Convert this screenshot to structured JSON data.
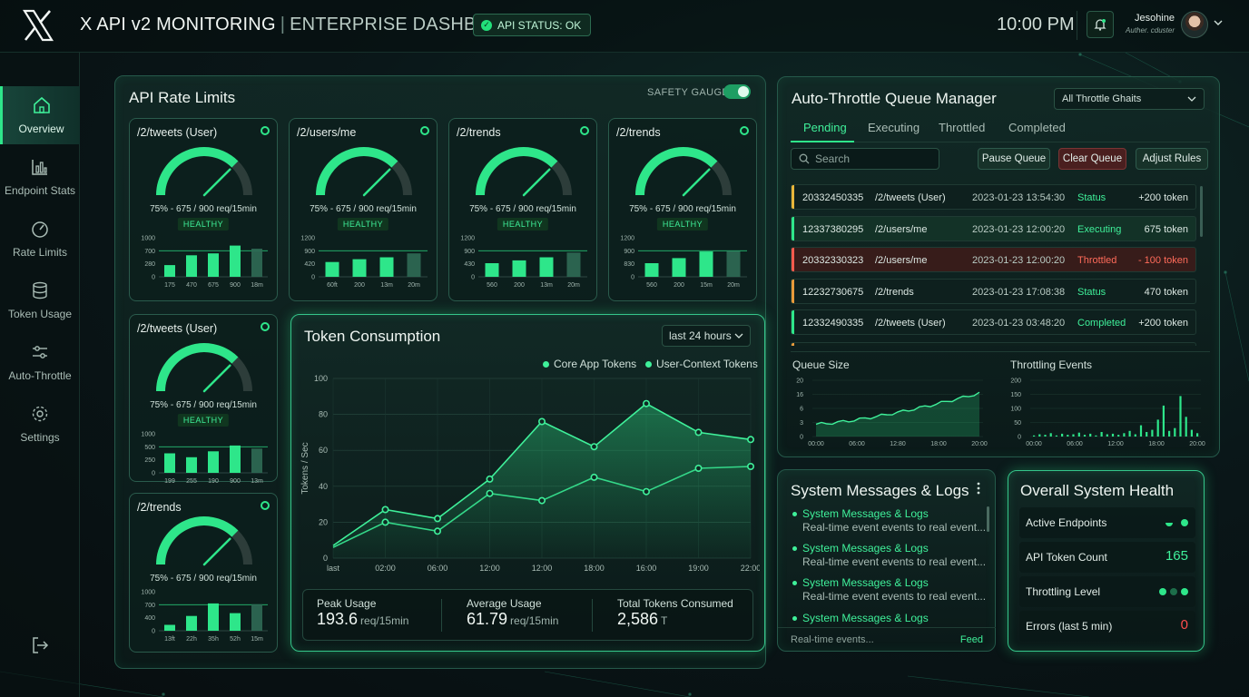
{
  "header": {
    "brand_main": "X API v2 MONITORING",
    "brand_sep": "|",
    "brand_sub": "ENTERPRISE DASHBOARD",
    "api_status": "API STATUS: OK",
    "time": "10:00 PM",
    "user_name": "Jesohine",
    "user_role": "Auther. cduster",
    "icons": {
      "logo": "x-logo-icon",
      "bell": "bell-icon",
      "chevron": "chevron-down-icon"
    }
  },
  "sidebar": {
    "items": [
      {
        "label": "Overview",
        "icon": "home-icon",
        "active": true
      },
      {
        "label": "Endpoint Stats",
        "icon": "bar-chart-icon",
        "active": false
      },
      {
        "label": "Rate Limits",
        "icon": "gauge-icon",
        "active": false
      },
      {
        "label": "Token Usage",
        "icon": "database-icon",
        "active": false
      },
      {
        "label": "Auto-Throttle",
        "icon": "sliders-icon",
        "active": false
      },
      {
        "label": "Settings",
        "icon": "gear-icon",
        "active": false
      }
    ],
    "logout_icon": "logout-icon"
  },
  "rate_limits": {
    "title": "API Rate Limits",
    "safety_label": "SAFETY GAUGE:",
    "safety_on": true,
    "endpoints": [
      {
        "name": "/2/tweets (User)",
        "reading": "75% - 675 / 900 req/15min",
        "usage": 0.75,
        "status": "HEALTHY",
        "bars": {
          "yticks": [
            "1000",
            "700",
            "280",
            "0"
          ],
          "xlabels": [
            "175",
            "470",
            "675",
            "900",
            "18m"
          ],
          "values": [
            0.3,
            0.55,
            0.6,
            0.8,
            0.72
          ]
        }
      },
      {
        "name": "/2/users/me",
        "reading": "75% - 675 / 900 req/15min",
        "usage": 0.75,
        "status": "HEALTHY",
        "bars": {
          "yticks": [
            "1200",
            "900",
            "420",
            "0"
          ],
          "xlabels": [
            "60ft",
            "200",
            "13m",
            "20m"
          ],
          "values": [
            0.38,
            0.45,
            0.5,
            0.6
          ]
        }
      },
      {
        "name": "/2/trends",
        "reading": "75% - 675 / 900 req/15min",
        "usage": 0.75,
        "status": "HEALTHY",
        "bars": {
          "yticks": [
            "1200",
            "900",
            "430",
            "0"
          ],
          "xlabels": [
            "560",
            "200",
            "13m",
            "20m"
          ],
          "values": [
            0.35,
            0.42,
            0.5,
            0.62
          ]
        }
      },
      {
        "name": "/2/trends",
        "reading": "75% - 675 / 900 req/15min",
        "usage": 0.75,
        "status": "HEALTHY",
        "bars": {
          "yticks": [
            "1200",
            "900",
            "830",
            "0"
          ],
          "xlabels": [
            "560",
            "200",
            "15m",
            "20m"
          ],
          "values": [
            0.35,
            0.48,
            0.65,
            0.66
          ]
        }
      },
      {
        "name": "/2/tweets (User)",
        "reading": "75% - 675 / 900 req/15min",
        "usage": 0.75,
        "status": "HEALTHY",
        "bars": {
          "yticks": [
            "1000",
            "500",
            "250",
            "0"
          ],
          "xlabels": [
            "199",
            "255",
            "190",
            "900",
            "13m"
          ],
          "values": [
            0.5,
            0.4,
            0.55,
            0.7,
            0.62
          ]
        }
      },
      {
        "name": "/2/trends",
        "reading": "75% - 675 / 900 req/15min",
        "usage": 0.75,
        "status": "",
        "bars": {
          "yticks": [
            "1000",
            "700",
            "400",
            "0"
          ],
          "xlabels": [
            "13ft",
            "22h",
            "35h",
            "52h",
            "15m"
          ],
          "values": [
            0.15,
            0.38,
            0.7,
            0.45,
            0.68
          ]
        }
      }
    ]
  },
  "token_consumption": {
    "title": "Token Consumption",
    "range": "last 24 hours",
    "legend": [
      "Core App Tokens",
      "User-Context Tokens"
    ],
    "stats": [
      {
        "label": "Peak Usage",
        "value": "193.6",
        "unit": "req/15min"
      },
      {
        "label": "Average Usage",
        "value": "61.79",
        "unit": "req/15min"
      },
      {
        "label": "Total Tokens Consumed",
        "value": "2,586",
        "unit": "T"
      }
    ]
  },
  "chart_data": {
    "type": "area",
    "title": "Token Consumption",
    "xlabel": "",
    "ylabel": "Tokens / Sec",
    "ylim": [
      0,
      100
    ],
    "yticks": [
      0,
      20,
      40,
      60,
      80,
      100
    ],
    "x": [
      "last",
      "02:00",
      "06:00",
      "12:00",
      "12:00",
      "18:00",
      "16:00",
      "19:00",
      "22:00"
    ],
    "series": [
      {
        "name": "Core App Tokens",
        "values": [
          7,
          27,
          22,
          44,
          76,
          62,
          86,
          70,
          66
        ]
      },
      {
        "name": "User-Context Tokens",
        "values": [
          6,
          20,
          15,
          36,
          32,
          45,
          37,
          50,
          51
        ]
      }
    ],
    "grid": true,
    "legend_position": "top-right"
  },
  "queue": {
    "title": "Auto-Throttle Queue Manager",
    "filter": "All Throttle Ghaits",
    "tabs": [
      "Pending",
      "Executing",
      "Throttled",
      "Completed"
    ],
    "active_tab": 0,
    "search_placeholder": "Search",
    "buttons": [
      "Pause Queue",
      "Clear Queue",
      "Adjust Rules"
    ],
    "rows": [
      {
        "id": "20332450335",
        "endpoint": "/2/tweets (User)",
        "time": "2023-01-23 13:54:30",
        "status": "Status",
        "tokens": "+200 token",
        "color": "#e8b53a"
      },
      {
        "id": "12337380295",
        "endpoint": "/2/users/me",
        "time": "2023-01-23 12:00:20",
        "status": "Executing",
        "tokens": "675 token",
        "color": "#2ee68a"
      },
      {
        "id": "20332330323",
        "endpoint": "/2/users/me",
        "time": "2023-01-23 12:00:20",
        "status": "Throttled",
        "tokens": "- 100 token",
        "color": "#ff5a4d"
      },
      {
        "id": "12232730675",
        "endpoint": "/2/trends",
        "time": "2023-01-23 17:08:38",
        "status": "Status",
        "tokens": "470 token",
        "color": "#e89a3a"
      },
      {
        "id": "12332490335",
        "endpoint": "/2/tweets (User)",
        "time": "2023-01-23 03:48:20",
        "status": "Completed",
        "tokens": "+200 token",
        "color": "#2ee68a"
      }
    ],
    "queue_size": {
      "title": "Queue Size",
      "yticks": [
        "20",
        "16",
        "6",
        "3",
        "0"
      ],
      "xlabels": [
        "00:00",
        "06:00",
        "12:80",
        "18:00",
        "20:00"
      ]
    },
    "throttling": {
      "title": "Throttling Events",
      "yticks": [
        "200",
        "150",
        "100",
        "50",
        "0"
      ],
      "xlabels": [
        "00:00",
        "06:00",
        "12:00",
        "18:00",
        "20:00"
      ]
    }
  },
  "logs": {
    "title": "System Messages & Logs",
    "items": [
      {
        "title": "System Messages & Logs",
        "desc": "Real-time event events to real event..."
      },
      {
        "title": "System Messages & Logs",
        "desc": "Real-time event events to real event..."
      },
      {
        "title": "System Messages & Logs",
        "desc": "Real-time event events to real event..."
      },
      {
        "title": "System Messages & Logs",
        "desc": ""
      }
    ],
    "footer_placeholder": "Real-time events...",
    "footer_link": "Feed"
  },
  "health": {
    "title": "Overall System Health",
    "rows": [
      {
        "label": "Active Endpoints",
        "value": ""
      },
      {
        "label": "API Token Count",
        "value": "165"
      },
      {
        "label": "Throttling Level",
        "value": ""
      },
      {
        "label": "Errors (last 5 min)",
        "value": "0"
      }
    ]
  }
}
